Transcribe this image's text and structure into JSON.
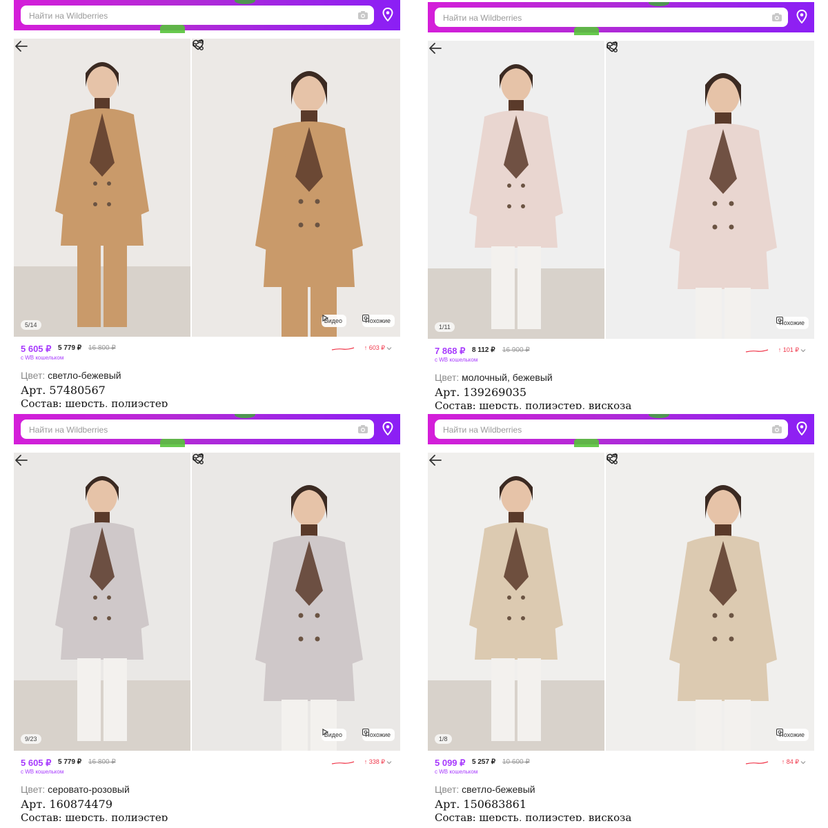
{
  "common": {
    "search_placeholder": "Найти на Wildberries",
    "video_label": "Видео",
    "similar_label": "Похожие",
    "wallet_label": "с WB кошельком",
    "color_label": "Цвет: "
  },
  "colors": {
    "brand_gradient_start": "#d41ed9",
    "brand_gradient_end": "#8b1ff5",
    "price_purple": "#a73afd",
    "trend_red": "#f0384b"
  },
  "panels": [
    {
      "counter": "5/14",
      "show_video": true,
      "price": "5 605 ₽",
      "price_second": "5 779 ₽",
      "price_old": "16 800 ₽",
      "trend": "↑ 603 ₽",
      "color_value": "светло-бежевый",
      "article": "Арт. 57480567",
      "composition": "Состав: шерсть, полиэстер",
      "coat_color": "#c99a6a",
      "bg_color": "#ece9e6"
    },
    {
      "counter": "1/11",
      "show_video": false,
      "price": "7 868 ₽",
      "price_second": "8 112 ₽",
      "price_old": "16 900 ₽",
      "trend": "↑ 101 ₽",
      "color_value": "молочный, бежевый",
      "article": "Арт. 139269035",
      "composition": "Состав: шерсть, полиэстер, вискоза",
      "coat_color": "#e9d6d0",
      "bg_color": "#efefef"
    },
    {
      "counter": "9/23",
      "show_video": true,
      "price": "5 605 ₽",
      "price_second": "5 779 ₽",
      "price_old": "16 800 ₽",
      "trend": "↑ 338 ₽",
      "color_value": "серовато-розовый",
      "article": "Арт. 160874479",
      "composition": "Состав: шерсть, полиэстер",
      "coat_color": "#cfc8c9",
      "bg_color": "#eae8e6"
    },
    {
      "counter": "1/8",
      "show_video": false,
      "price": "5 099 ₽",
      "price_second": "5 257 ₽",
      "price_old": "10 600 ₽",
      "trend": "↑ 84 ₽",
      "color_value": "светло-бежевый",
      "article": "Арт. 150683861",
      "composition": "Состав: шерсть, полиэстер, вискоза",
      "coat_color": "#dccab1",
      "bg_color": "#f0efed"
    }
  ]
}
